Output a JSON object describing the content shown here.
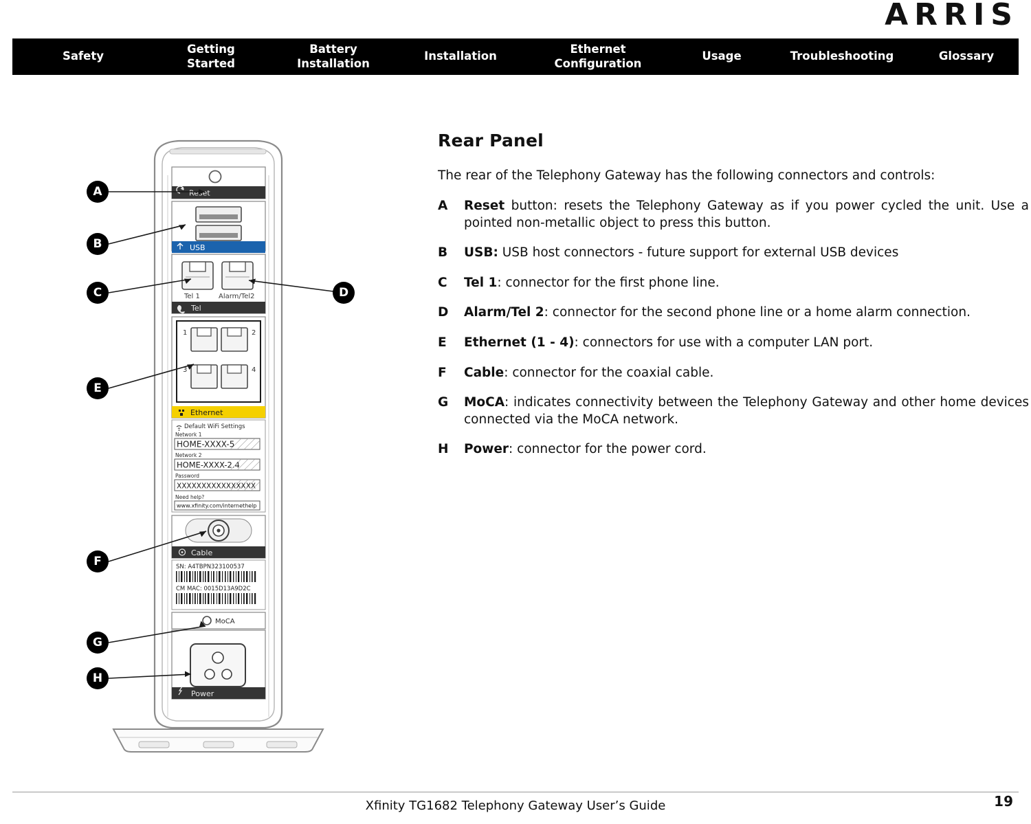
{
  "brand": {
    "logo_text": "ARRIS"
  },
  "nav": {
    "items": [
      {
        "name": "safety",
        "label": "Safety"
      },
      {
        "name": "getting-started",
        "label": "Getting\nStarted"
      },
      {
        "name": "battery-installation",
        "label": "Battery\nInstallation"
      },
      {
        "name": "installation",
        "label": "Installation"
      },
      {
        "name": "ethernet-configuration",
        "label": "Ethernet\nConfiguration"
      },
      {
        "name": "usage",
        "label": "Usage"
      },
      {
        "name": "troubleshooting",
        "label": "Troubleshooting"
      },
      {
        "name": "glossary",
        "label": "Glossary"
      }
    ]
  },
  "main": {
    "title": "Rear Panel",
    "intro": "The rear of the Telephony Gateway has the following connectors and controls:",
    "items": [
      {
        "key": "A",
        "term": "Reset",
        "rest": " button: resets the Telephony Gateway as if you power cycled the unit. Use a pointed non-metallic object to press this button."
      },
      {
        "key": "B",
        "term": "USB:",
        "rest": " USB host connectors - future support for external USB devices"
      },
      {
        "key": "C",
        "term": "Tel 1",
        "rest": ": connector for the first phone line."
      },
      {
        "key": "D",
        "term": "Alarm/Tel 2",
        "rest": ": connector for the second phone line or a home alarm connection."
      },
      {
        "key": "E",
        "term": "Ethernet (1 - 4)",
        "rest": ": connectors for use with a computer LAN port."
      },
      {
        "key": "F",
        "term": "Cable",
        "rest": ": connector for the coaxial cable."
      },
      {
        "key": "G",
        "term": "MoCA",
        "rest": ": indicates connectivity between the Telephony Gateway and other home devices connected via the MoCA network."
      },
      {
        "key": "H",
        "term": "Power",
        "rest": ": connector for the power cord."
      }
    ]
  },
  "figure": {
    "alt": "Rear panel of Xfinity TG1682 Telephony Gateway with labeled callouts",
    "callouts": [
      {
        "key": "A",
        "target": "reset-button"
      },
      {
        "key": "B",
        "target": "usb-ports"
      },
      {
        "key": "C",
        "target": "tel-1-jack"
      },
      {
        "key": "D",
        "target": "alarm-tel-2-jack"
      },
      {
        "key": "E",
        "target": "ethernet-ports"
      },
      {
        "key": "F",
        "target": "cable-connector"
      },
      {
        "key": "G",
        "target": "moca-led"
      },
      {
        "key": "H",
        "target": "power-connector"
      }
    ],
    "panel_labels": {
      "reset": "Reset",
      "usb": "USB",
      "tel_1": "Tel 1",
      "alarm_tel_2": "Alarm/Tel2",
      "tel": "Tel",
      "ethernet": "Ethernet",
      "ethernet_port_1": "1",
      "ethernet_port_2": "2",
      "ethernet_port_3": "3",
      "ethernet_port_4": "4",
      "cable": "Cable",
      "moca": "MoCA",
      "power": "Power"
    },
    "wifi_label_block": {
      "heading": "Default WiFi Settings",
      "network_1_label": "Network 1",
      "network_1_value": "HOME-XXXX-5",
      "network_2_label": "Network 2",
      "network_2_value": "HOME-XXXX-2.4",
      "password_label": "Password",
      "password_value": "XXXXXXXXXXXXXXXX",
      "help_label": "Need help?",
      "help_url": "www.xfinity.com/internethelp"
    },
    "serial_block": {
      "sn": "SN: A4TBPN323100537",
      "cm_mac": "CM MAC: 0015D13A9D2C"
    },
    "colors": {
      "usb_band": "#1b63ad",
      "ethernet_band": "#f5d000",
      "panel_dark": "#2e2e2e",
      "outline": "#6d6d6d"
    }
  },
  "footer": {
    "title": "Xfinity TG1682 Telephony Gateway User’s Guide",
    "page": "19"
  }
}
